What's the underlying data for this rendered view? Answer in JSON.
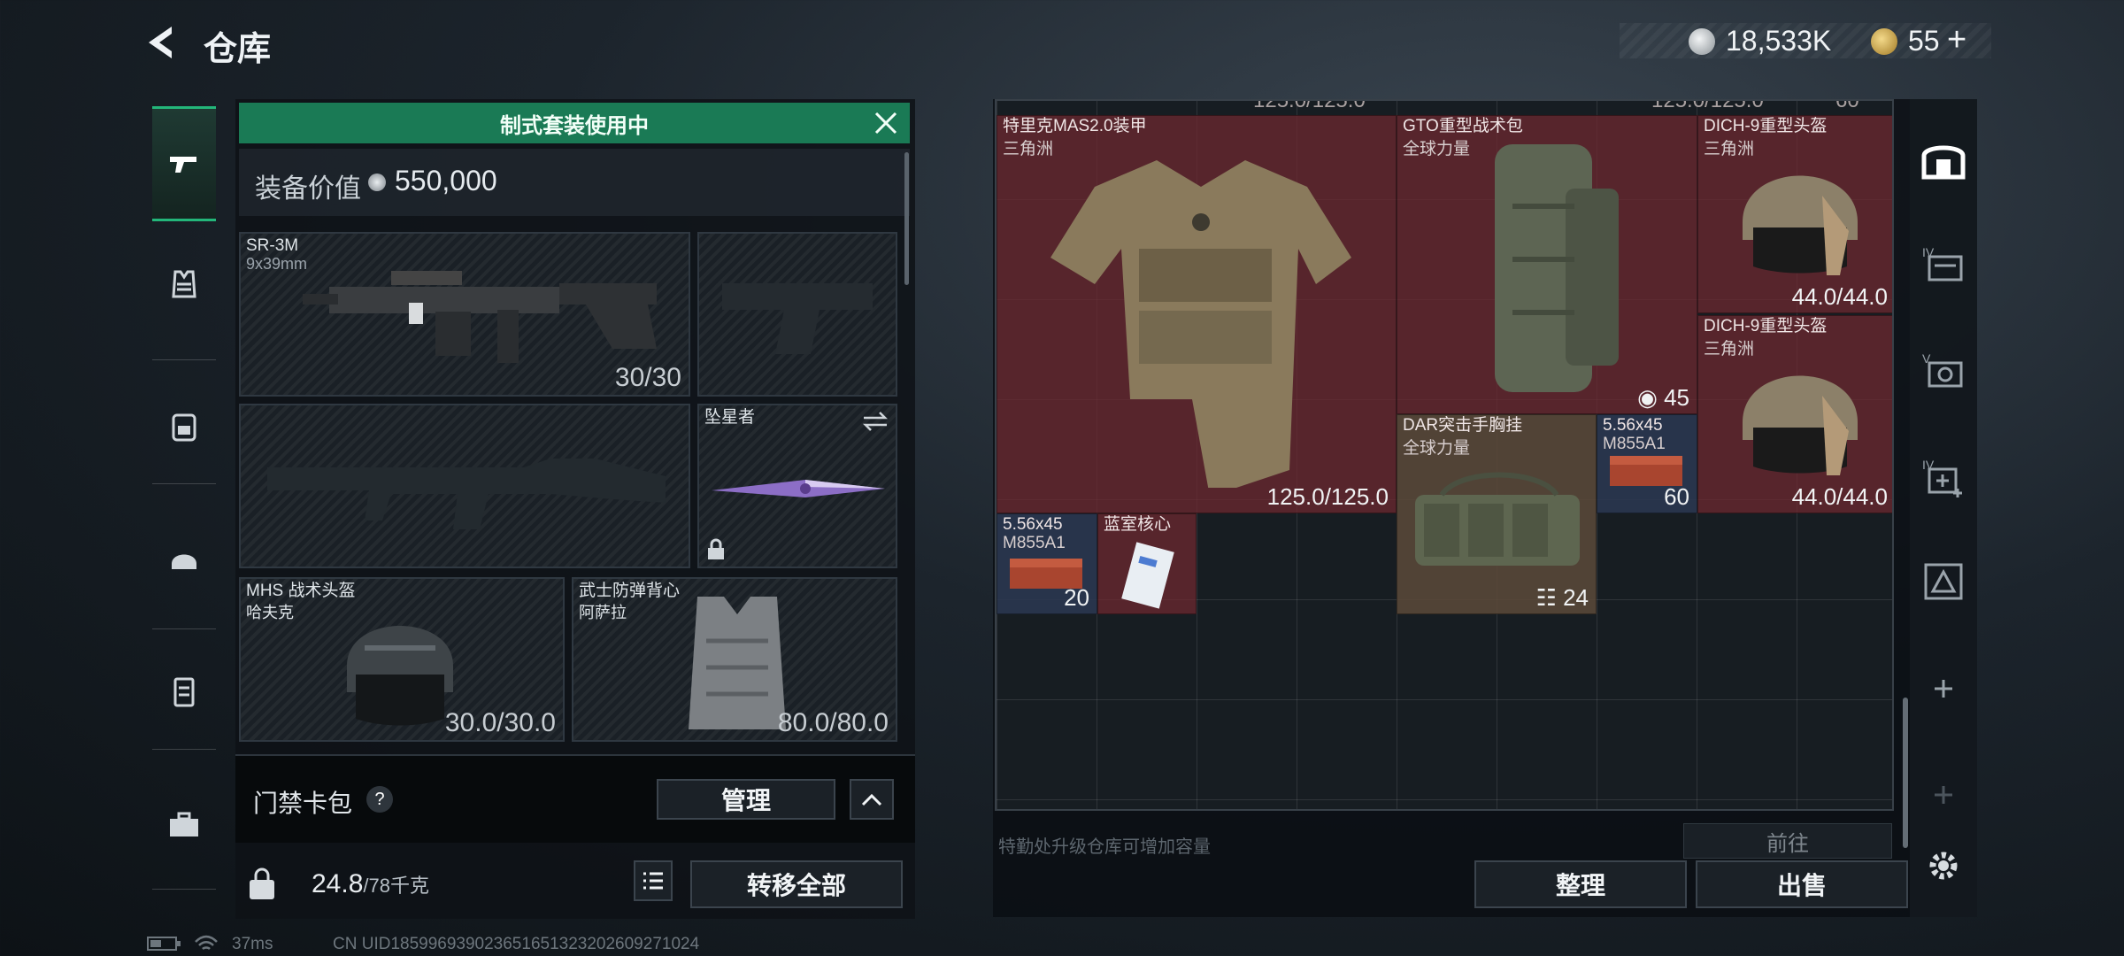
{
  "header": {
    "title": "仓库",
    "currency_silver": "18,533K",
    "currency_gold": "55",
    "currency_gold_add": "+"
  },
  "left_nav": {
    "items": [
      "pistol-icon",
      "vest-icon",
      "helmet-icon",
      "backpack-icon",
      "chest-rig-icon",
      "toolbox-icon"
    ],
    "active": "pistol-icon"
  },
  "loadout": {
    "banner": "制式套装使用中",
    "value_label": "装备价值",
    "value": "550,000",
    "primary": {
      "name": "SR-3M",
      "caliber": "9x39mm",
      "ammo": "30/30"
    },
    "melee": {
      "name": "坠星者"
    },
    "helmet": {
      "name": "MHS 战术头盔",
      "sub": "哈夫克",
      "durability": "30.0/30.0"
    },
    "armor": {
      "name": "武士防弹背心",
      "sub": "阿萨拉",
      "durability": "80.0/80.0"
    },
    "keycard_label": "门禁卡包",
    "keycard_help": "?",
    "manage_label": "管理",
    "weight": "24.8",
    "weight_unit": "/78千克",
    "transfer_all": "转移全部"
  },
  "stash": {
    "top_cut_left": "125.0/125.0",
    "top_cut_right": "125.0/125.0",
    "top_cut_far": "60",
    "items": {
      "vest": {
        "name": "特里克MAS2.0装甲",
        "sub": "三角洲",
        "durability": "125.0/125.0"
      },
      "backpack": {
        "name": "GTO重型战术包",
        "sub": "全球力量",
        "count": "45"
      },
      "helmet1": {
        "name": "DICH-9重型头盔",
        "sub": "三角洲",
        "durability": "44.0/44.0"
      },
      "helmet2": {
        "name": "DICH-9重型头盔",
        "sub": "三角洲",
        "durability": "44.0/44.0"
      },
      "rig": {
        "name": "DAR突击手胸挂",
        "sub": "全球力量",
        "count": "24"
      },
      "ammo1": {
        "name": "5.56x45",
        "sub": "M855A1",
        "count": "60"
      },
      "ammo2": {
        "name": "5.56x45",
        "sub": "M855A1",
        "count": "20"
      },
      "card": {
        "name": "蓝室核心"
      }
    },
    "hint": "特勤处升级仓库可增加容量",
    "goto": "前往",
    "sort_label": "整理",
    "sell_label": "出售"
  },
  "status": {
    "ping": "37ms",
    "uid": "CN UID1859969390236516513232026092710​24"
  }
}
